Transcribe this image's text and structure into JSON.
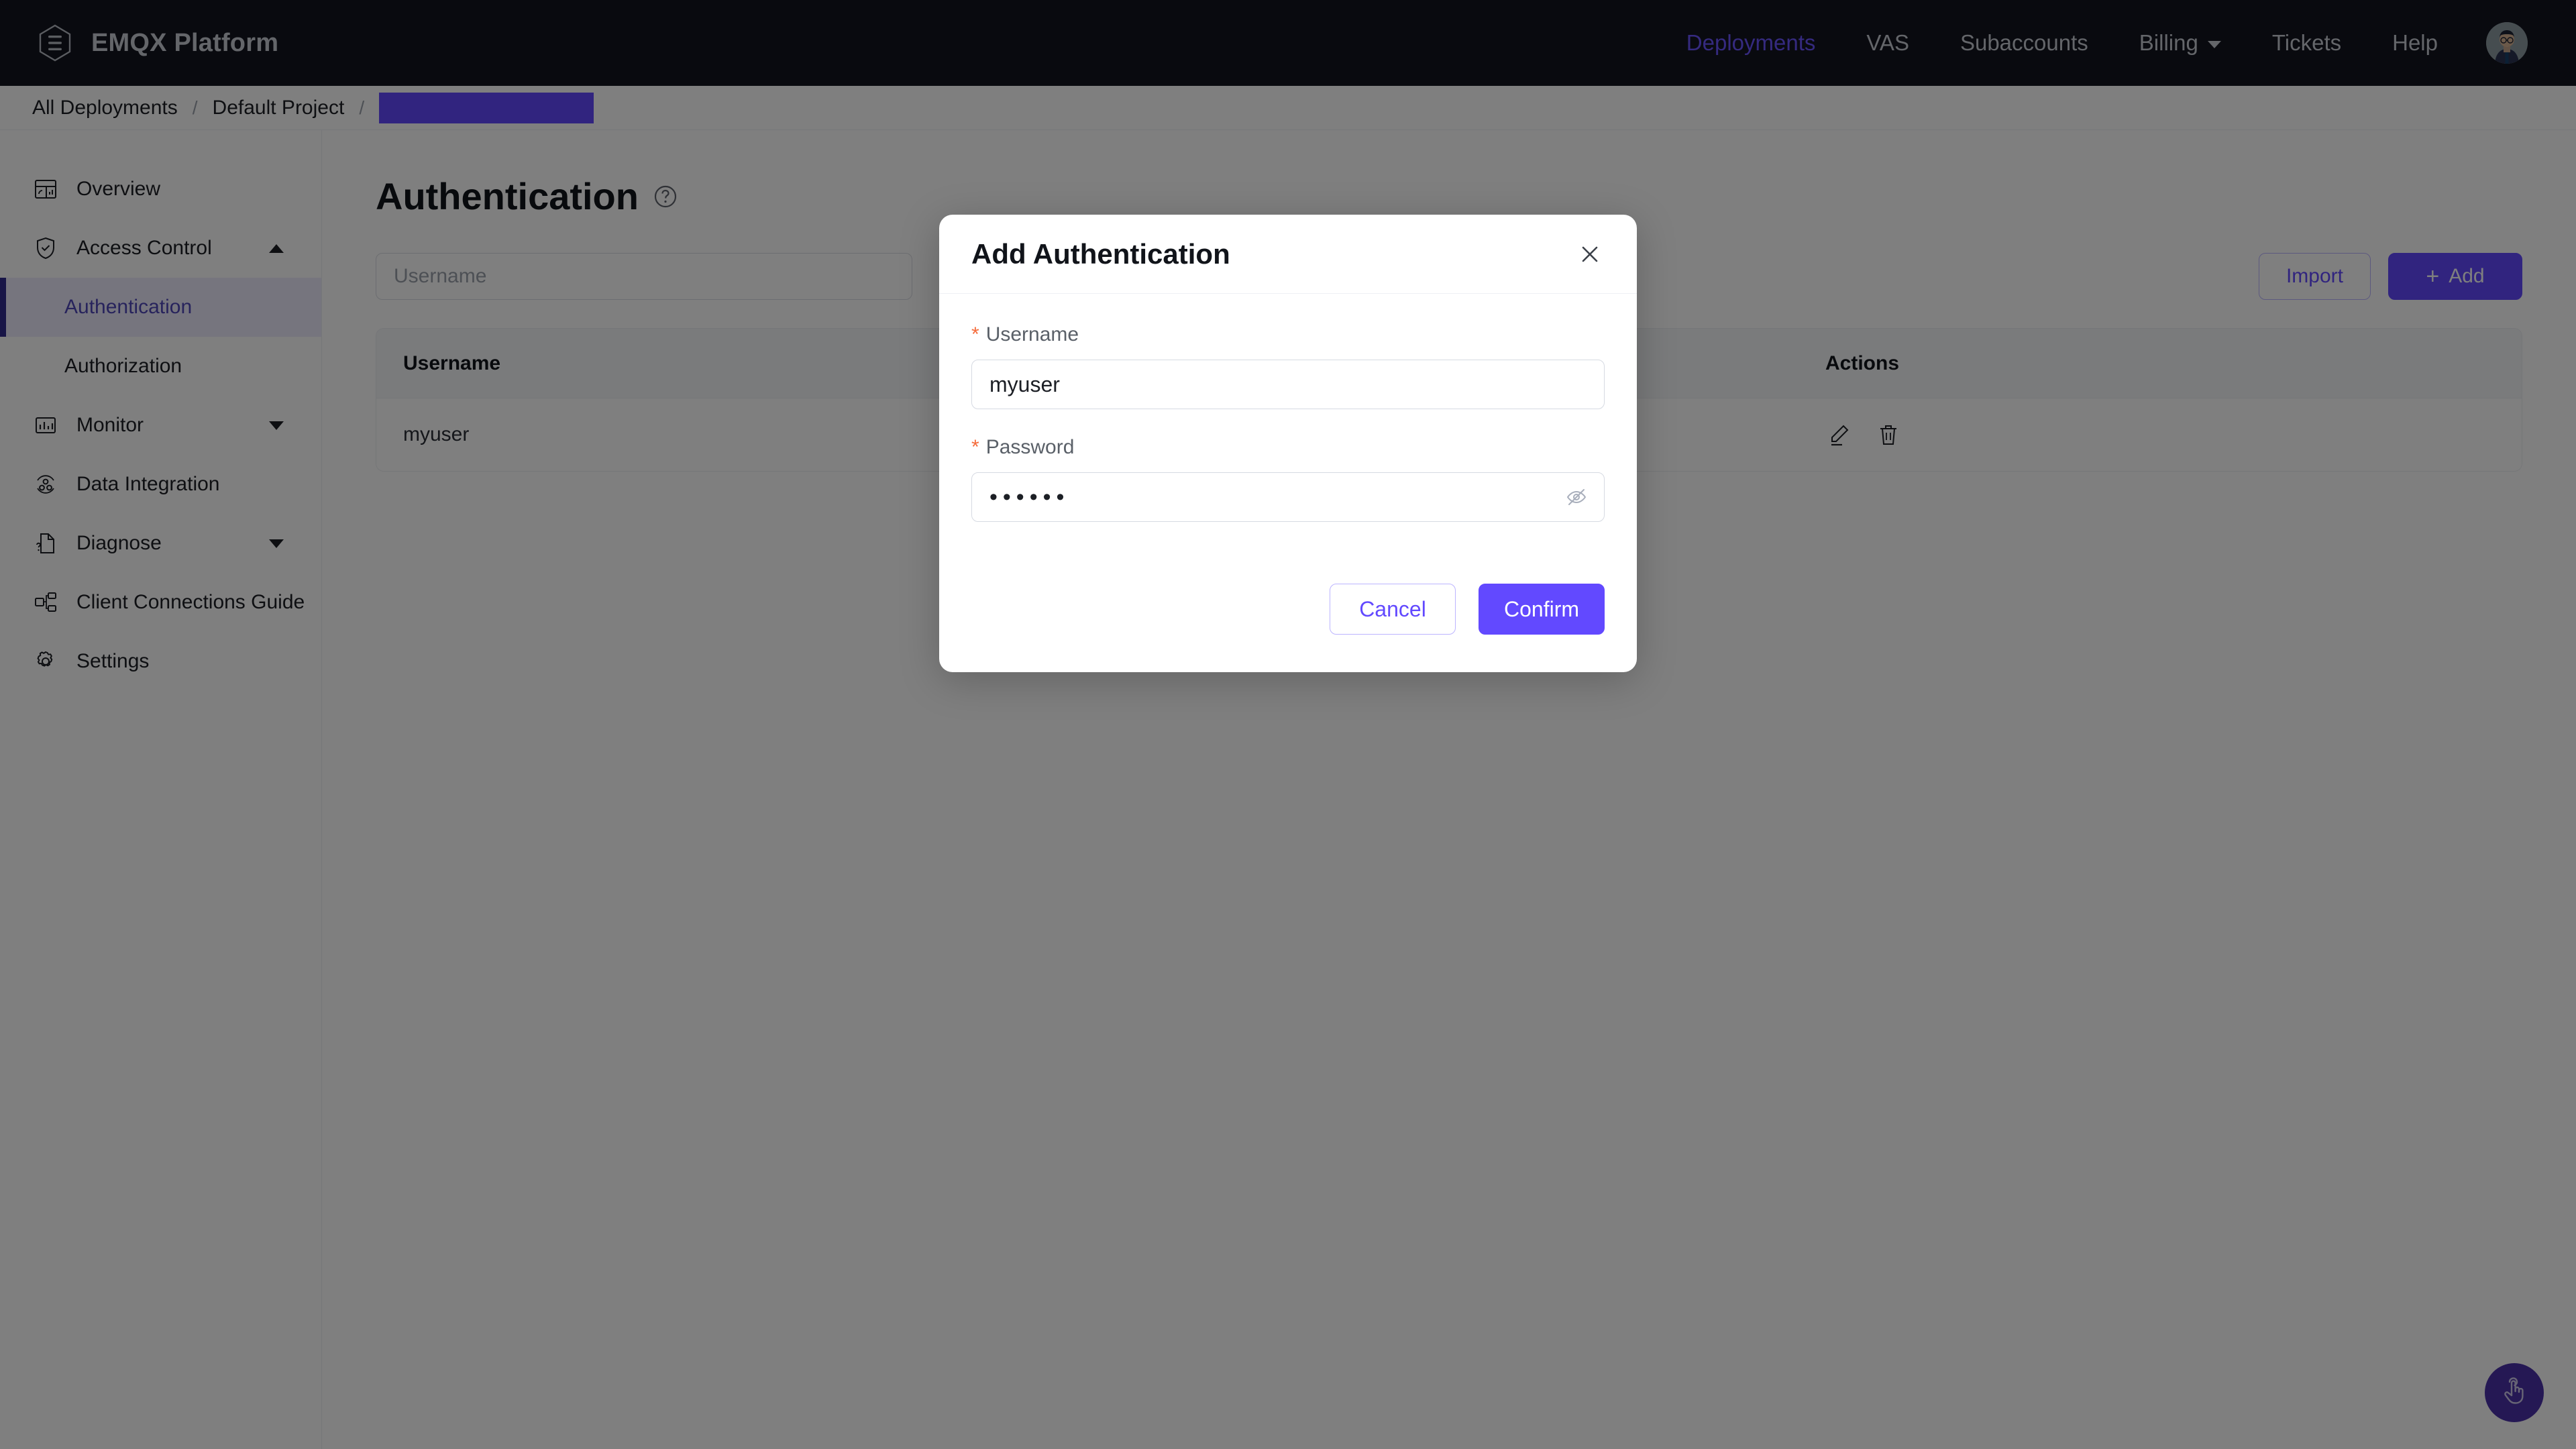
{
  "topnav": {
    "brand": "EMQX Platform",
    "logo_icon": "emqx-hexagon-logo",
    "items": [
      {
        "label": "Deployments",
        "active": true
      },
      {
        "label": "VAS",
        "active": false
      },
      {
        "label": "Subaccounts",
        "active": false
      },
      {
        "label": "Billing",
        "active": false,
        "has_dropdown": true
      },
      {
        "label": "Tickets",
        "active": false
      },
      {
        "label": "Help",
        "active": false
      }
    ],
    "avatar_icon": "user-avatar"
  },
  "breadcrumb": {
    "items": [
      "All Deployments",
      "Default Project"
    ],
    "separator": "/",
    "redacted_color": "#6249ff"
  },
  "sidebar": {
    "items": [
      {
        "label": "Overview",
        "icon": "dashboard-icon"
      },
      {
        "label": "Access Control",
        "icon": "shield-check-icon",
        "expanded": true
      },
      {
        "label": "Authentication",
        "sub": true,
        "active": true
      },
      {
        "label": "Authorization",
        "sub": true,
        "active": false
      },
      {
        "label": "Monitor",
        "icon": "chart-bars-icon",
        "expanded": false
      },
      {
        "label": "Data Integration",
        "icon": "data-integration-icon"
      },
      {
        "label": "Diagnose",
        "icon": "diagnose-file-icon",
        "expanded": false
      },
      {
        "label": "Client Connections Guide",
        "icon": "connections-icon"
      },
      {
        "label": "Settings",
        "icon": "gear-icon"
      }
    ]
  },
  "main": {
    "page_title": "Authentication",
    "help_icon": "question-circle-icon",
    "search": {
      "placeholder": "Username",
      "value": ""
    },
    "import_label": "Import",
    "add_label": "Add",
    "add_icon": "plus-icon",
    "table": {
      "columns": [
        "Username",
        "Actions"
      ],
      "rows": [
        {
          "username": "myuser",
          "actions": [
            "edit-icon",
            "delete-icon"
          ]
        }
      ]
    },
    "fab_icon": "hand-pointer-icon"
  },
  "modal": {
    "title": "Add Authentication",
    "close_icon": "close-icon",
    "required_marker": "*",
    "fields": [
      {
        "label": "Username",
        "value": "myuser",
        "type": "text",
        "required": true
      },
      {
        "label": "Password",
        "value": "••••••",
        "type": "password",
        "required": true,
        "toggle_icon": "eye-off-icon"
      }
    ],
    "cancel_label": "Cancel",
    "confirm_label": "Confirm"
  },
  "colors": {
    "accent": "#6249ff",
    "topnav_bg": "#12151f",
    "required_star": "#f56c3c",
    "sidebar_active_bg": "#ecebfd",
    "sidebar_active_bar": "#312b8f"
  }
}
